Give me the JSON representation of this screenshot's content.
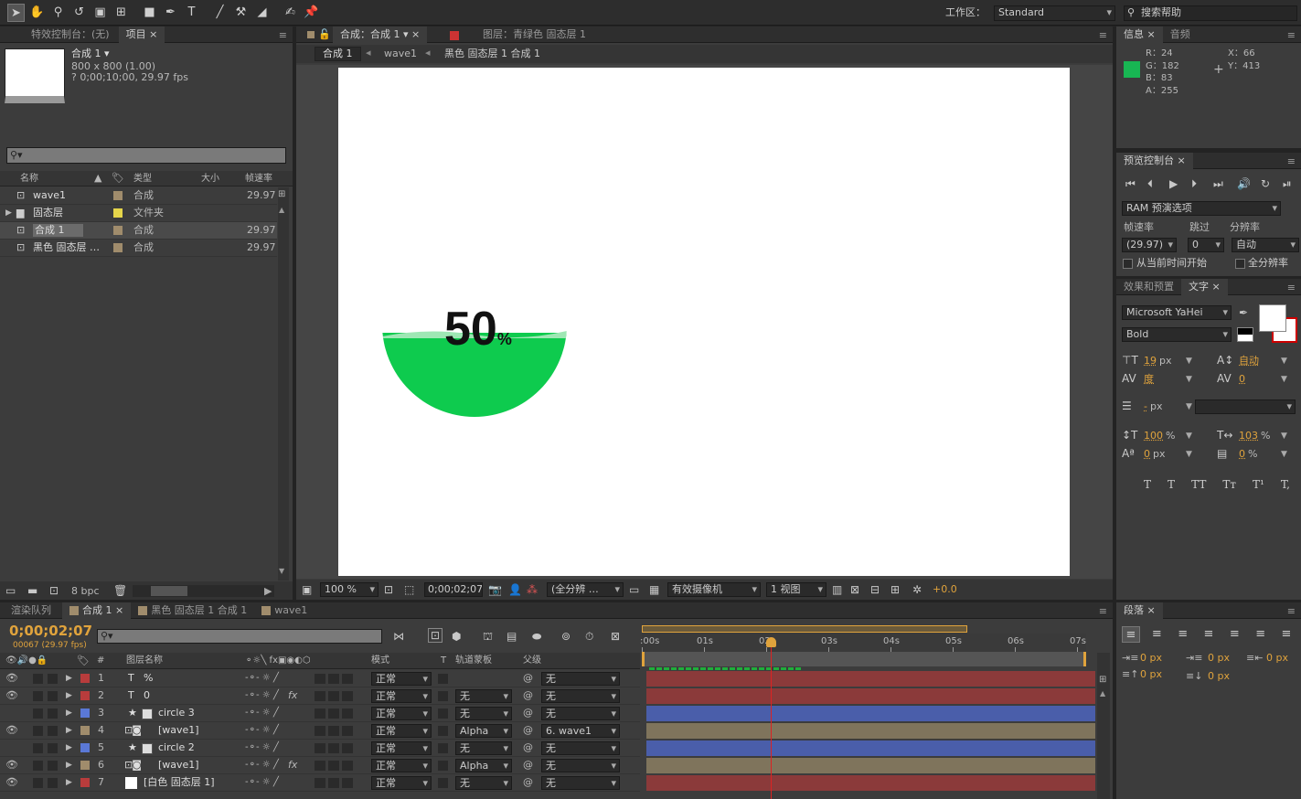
{
  "toolbar": {
    "workspace_label": "工作区：",
    "workspace_value": "Standard",
    "search_placeholder": "搜索帮助",
    "tools": [
      "selection-tool-icon",
      "hand-tool-icon",
      "zoom-tool-icon",
      "rotate-tool-icon",
      "camera-tool-icon",
      "pan-behind-tool-icon",
      "rectangle-tool-icon",
      "pen-tool-icon",
      "text-tool-icon",
      "brush-tool-icon",
      "clone-stamp-tool-icon",
      "eraser-tool-icon",
      "roto-brush-tool-icon",
      "puppet-pin-tool-icon"
    ]
  },
  "project": {
    "tabs": [
      "特效控制台：(无)",
      "项目"
    ],
    "item_name": "合成 1 ▾",
    "item_size": "800 x 800 (1.00)",
    "item_duration": "? 0;00;10;00, 29.97 fps",
    "search_placeholder": "",
    "columns": [
      "名称",
      "类型",
      "大小",
      "帧速率"
    ],
    "items": [
      {
        "name": "wave1",
        "type": "合成",
        "fps": "29.97",
        "color": "#a08c6c",
        "icon": "composition-icon"
      },
      {
        "name": "固态层",
        "type": "文件夹",
        "fps": "",
        "color": "#e5d54a",
        "icon": "folder-icon"
      },
      {
        "name": "合成 1",
        "type": "合成",
        "fps": "29.97",
        "color": "#a08c6c",
        "icon": "composition-icon"
      },
      {
        "name": "黑色 固态层 …",
        "type": "合成",
        "fps": "29.97",
        "color": "#a08c6c",
        "icon": "composition-icon"
      }
    ],
    "bpc": "8 bpc"
  },
  "comp": {
    "tabs": [
      "合成：合成 1",
      "图层：青绿色 固态层 1"
    ],
    "breadcrumbs": [
      "合成 1",
      "wave1",
      "黑色 固态层 1 合成 1"
    ],
    "preview_text": "50",
    "preview_percent": "%",
    "fill_color": "#0ecb4e",
    "fill_level": 0.5,
    "footer": {
      "zoom": "100 %",
      "timecode": "0;00;02;07",
      "resolution": "(全分辨 …",
      "camera": "有效摄像机",
      "views": "1 视图",
      "exposure": "+0.0"
    }
  },
  "info": {
    "tabs": [
      "信息",
      "音频"
    ],
    "r": "R：24",
    "g": "G：182",
    "b": "B：83",
    "a": "A：255",
    "x": "X：66",
    "y": "Y：413",
    "color": "#18b653"
  },
  "preview": {
    "title": "预览控制台",
    "ram_option": "RAM 预演选项",
    "labels": [
      "帧速率",
      "跳过",
      "分辨率"
    ],
    "fps": "(29.97)",
    "skip": "0",
    "res": "自动",
    "from_current": "从当前时间开始",
    "full_res": "全分辨率"
  },
  "character": {
    "tabs": [
      "效果和预置",
      "文字"
    ],
    "font": "Microsoft YaHei",
    "style": "Bold",
    "size": "19",
    "size_unit": "px",
    "leading": "自动",
    "kerning": "度",
    "tracking": "0",
    "stroke": "-",
    "stroke_unit": "px",
    "vscale": "100",
    "vscale_unit": "%",
    "hscale": "103",
    "hscale_unit": "%",
    "baseline": "0",
    "baseline_unit": "px",
    "tsume": "0",
    "tsume_unit": "%",
    "styles": [
      "T",
      "T",
      "TT",
      "Tт",
      "T¹",
      "T,"
    ]
  },
  "timeline": {
    "tabs": [
      "渲染队列",
      "合成 1",
      "黑色 固态层 1 合成 1",
      "wave1"
    ],
    "timecode": "0;00;02;07",
    "frame_info": "00067 (29.97 fps)",
    "search_placeholder": "",
    "columns": [
      "#",
      "图层名称",
      "模式",
      "T",
      "轨道蒙板",
      "父级"
    ],
    "ruler": [
      ":00s",
      "01s",
      "02s",
      "03s",
      "04s",
      "05s",
      "06s",
      "07s"
    ],
    "playhead_fraction": 0.296,
    "layers": [
      {
        "num": "1",
        "name": "%",
        "type": "text",
        "color": "#b83c3c",
        "mode": "正常",
        "track": "",
        "parent": "无",
        "fx": false,
        "bar": "#8b3a3a"
      },
      {
        "num": "2",
        "name": "0",
        "type": "text",
        "color": "#b83c3c",
        "mode": "正常",
        "track": "无",
        "parent": "无",
        "fx": true,
        "bar": "#8b3a3a"
      },
      {
        "num": "3",
        "name": "circle 3",
        "type": "shape",
        "color": "#5a78d6",
        "mode": "正常",
        "track": "无",
        "parent": "无",
        "fx": false,
        "bar": "#4a5eaa"
      },
      {
        "num": "4",
        "name": "[wave1]",
        "type": "comp",
        "color": "#a08c6c",
        "mode": "正常",
        "track": "Alpha",
        "parent": "6. wave1",
        "fx": false,
        "bar": "#7f745c"
      },
      {
        "num": "5",
        "name": "circle 2",
        "type": "shape",
        "color": "#5a78d6",
        "mode": "正常",
        "track": "无",
        "parent": "无",
        "fx": false,
        "bar": "#4a5eaa"
      },
      {
        "num": "6",
        "name": "[wave1]",
        "type": "comp",
        "color": "#a08c6c",
        "mode": "正常",
        "track": "Alpha",
        "parent": "无",
        "fx": true,
        "bar": "#7f745c"
      },
      {
        "num": "7",
        "name": "[白色 固态层 1]",
        "type": "solid",
        "color": "#b83c3c",
        "mode": "正常",
        "track": "无",
        "parent": "无",
        "fx": false,
        "bar": "#8b3a3a"
      }
    ]
  },
  "paragraph": {
    "tab": "段落",
    "indent_left": "0 px",
    "indent_first": "0 px",
    "indent_right": "0 px",
    "space_before": "0 px",
    "space_after": "0 px"
  }
}
